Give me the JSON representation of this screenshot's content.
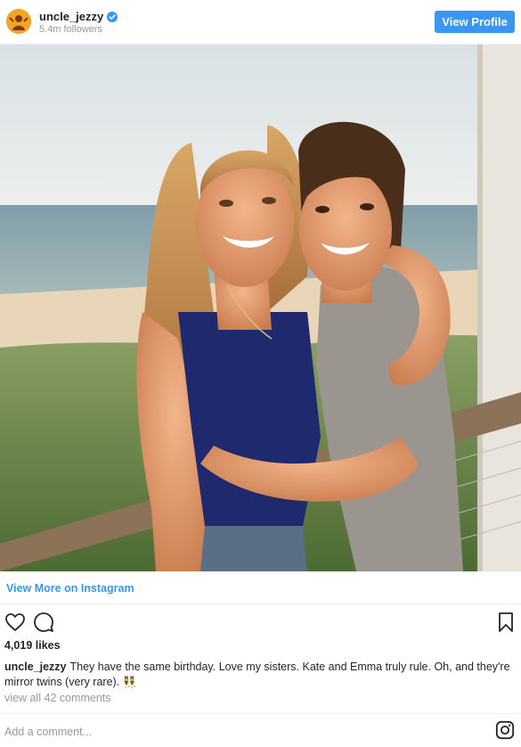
{
  "header": {
    "username": "uncle_jezzy",
    "followers": "5.4m followers",
    "view_profile_label": "View Profile",
    "verified_icon": "verified-badge-icon"
  },
  "post": {
    "image_alt": "Two smiling girls hugging on a deck by the beach",
    "view_more_label": "View More on Instagram",
    "likes": "4,019 likes",
    "caption_user": "uncle_jezzy",
    "caption_text": "They have the same birthday. Love my sisters. Kate and Emma truly rule. Oh, and they're mirror twins (very rare). 👯",
    "view_comments": "view all 42 comments",
    "comment_placeholder": "Add a comment..."
  },
  "icons": {
    "like": "heart-icon",
    "comment": "comment-icon",
    "save": "bookmark-icon",
    "instagram": "instagram-logo-icon"
  },
  "colors": {
    "accent": "#3897f0",
    "text": "#262626",
    "muted": "#999999",
    "border": "#efefef"
  }
}
